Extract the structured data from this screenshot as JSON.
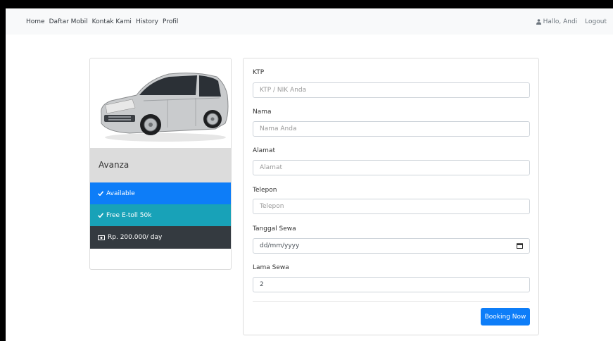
{
  "nav": {
    "links": [
      "Home",
      "Daftar Mobil",
      "Kontak Kami",
      "History",
      "Profil"
    ],
    "user_greeting": "Hallo, Andi",
    "logout_label": "Logout"
  },
  "car": {
    "name": "Avanza",
    "status_label": "Available",
    "toll_label": "Free E-toll 50k",
    "price_label": "Rp. 200.000/ day",
    "colors": {
      "available": "#0d7df8",
      "toll": "#18a2b8",
      "price": "#343a40"
    }
  },
  "form": {
    "ktp": {
      "label": "KTP",
      "placeholder": "KTP / NIK Anda"
    },
    "nama": {
      "label": "Nama",
      "placeholder": "Nama Anda"
    },
    "alamat": {
      "label": "Alamat",
      "placeholder": "Alamat"
    },
    "telepon": {
      "label": "Telepon",
      "placeholder": "Telepon"
    },
    "tanggal_sewa": {
      "label": "Tanggal Sewa",
      "placeholder": "dd/mm/yyyy"
    },
    "lama_sewa": {
      "label": "Lama Sewa",
      "value": "2"
    },
    "submit_label": "Booking Now"
  },
  "icons": {
    "user": "user-icon",
    "check": "check-icon",
    "money": "money-icon",
    "calendar": "calendar-icon"
  }
}
